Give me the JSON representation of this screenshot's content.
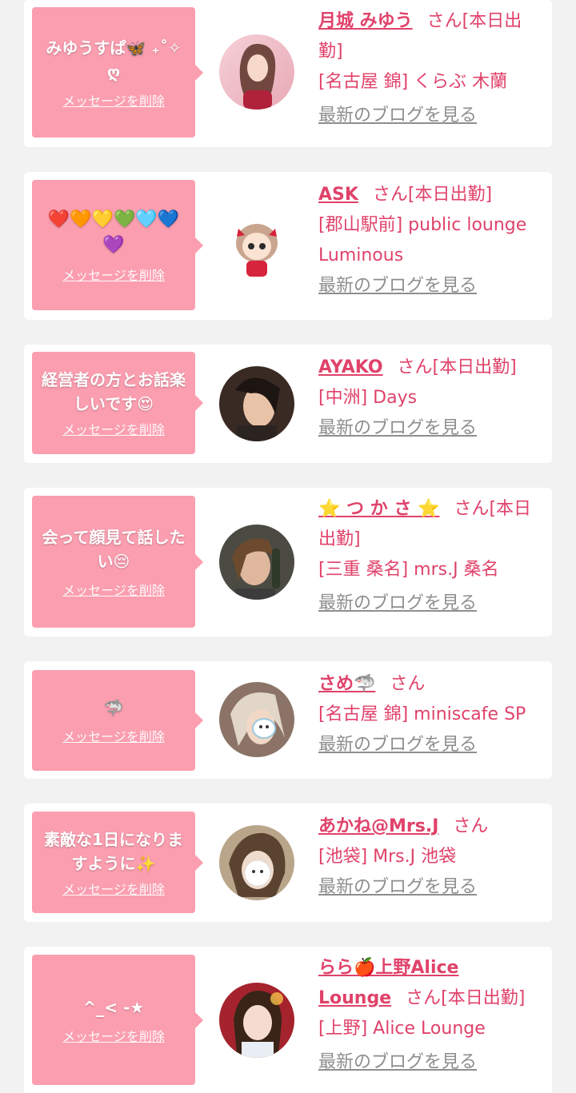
{
  "delete_label": "メッセージを削除",
  "blog_label": "最新のブログを見る",
  "colors": {
    "bubble": "#fb9eb0",
    "accent": "#e0426a",
    "link_gray": "#8e8e8e",
    "background": "#f2f2f2"
  },
  "entries": [
    {
      "message": "みゆうすぱ🦋 ₊˚✧ღ",
      "name": "月城 みゆう",
      "suffix": "さん[本日出勤]",
      "shop": "[名古屋 錦] くらぶ 木蘭",
      "avatar": "avatar-photo"
    },
    {
      "message": "❤️🧡💛💚🩵💙💜",
      "name": "ASK",
      "suffix": "さん[本日出勤]",
      "shop": "[郡山駅前] public lounge Luminous",
      "avatar": "avatar-character"
    },
    {
      "message": "経営者の方とお話楽しいです😍",
      "name": "AYAKO",
      "suffix": "さん[本日出勤]",
      "shop": "[中洲] Days",
      "avatar": "avatar-photo"
    },
    {
      "message": "会って顔見て話したい😔",
      "name": "⭐ つ か さ ⭐",
      "suffix": "さん[本日出勤]",
      "shop": "[三重 桑名] mrs.J 桑名",
      "avatar": "avatar-photo"
    },
    {
      "message": "🦈",
      "name": "さめ🦈",
      "suffix": "さん",
      "shop": "[名古屋 錦] miniscafe SP",
      "avatar": "avatar-photo"
    },
    {
      "message": "素敵な1日になりますように✨",
      "name": "あかね@Mrs.J",
      "suffix": "さん",
      "shop": "[池袋] Mrs.J 池袋",
      "avatar": "avatar-photo"
    },
    {
      "message": "^_< -★",
      "name": "らら🍎上野Alice Lounge",
      "suffix": "さん[本日出勤]",
      "shop": "[上野] Alice Lounge",
      "avatar": "avatar-photo"
    }
  ]
}
